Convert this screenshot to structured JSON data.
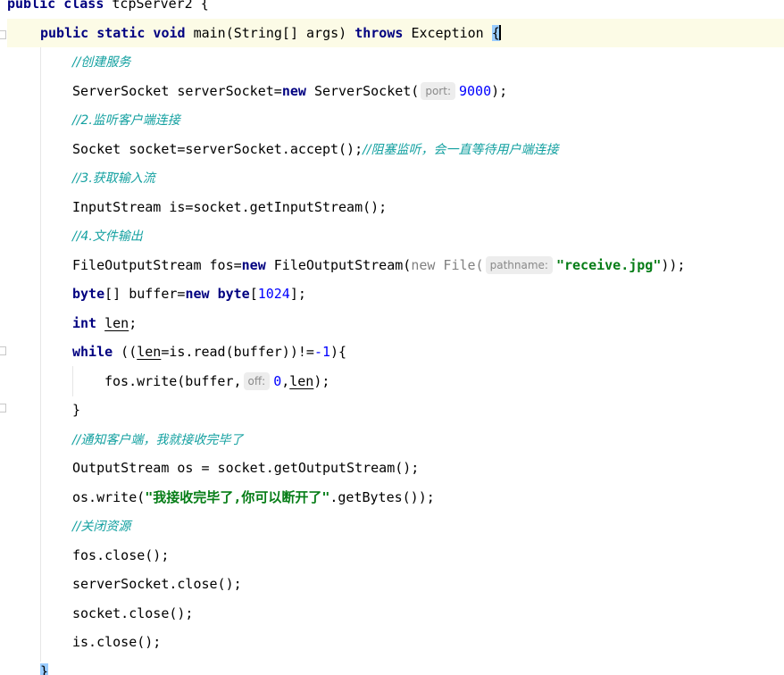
{
  "code": {
    "class_decl": {
      "kw": "public class",
      "name": "tcpServer2",
      "brace": "{"
    },
    "main_decl": {
      "kw": "public static void",
      "name": "main(String[] args)",
      "throws_kw": "throws",
      "exc": "Exception",
      "brace": "{"
    },
    "comment_create": "//创建服务",
    "server_socket": {
      "decl": "ServerSocket serverSocket=",
      "kw": "new",
      "ctor": "ServerSocket(",
      "hint": "port:",
      "num": "9000",
      "end": ");"
    },
    "comment_listen": "//2.监听客户端连接",
    "accept_line": {
      "code": "Socket socket=serverSocket.accept();",
      "comment": "//阻塞监听，会一直等待用户端连接"
    },
    "comment_input": "//3.获取输入流",
    "input_stream": "InputStream is=socket.getInputStream();",
    "comment_output": "//4.文件输出",
    "fos_line": {
      "decl": "FileOutputStream fos=",
      "kw": "new",
      "ctor": "FileOutputStream(",
      "inner": "new File(",
      "hint": "pathname:",
      "str": "\"receive.jpg\"",
      "end": "));"
    },
    "buffer_line": {
      "kw1": "byte",
      "mid": "[] buffer=",
      "kw2": "new",
      "kw3": "byte",
      "open": "[",
      "num": "1024",
      "end": "];"
    },
    "int_line": {
      "kw": "int",
      "var": "len",
      "end": ";"
    },
    "while_line": {
      "kw": "while",
      "p1": " ((",
      "var": "len",
      "p2": "=is.read(buffer))!=",
      "num": "-1",
      "end": "){"
    },
    "write_line": {
      "p1": "fos.write(buffer,",
      "hint": "off:",
      "num": "0",
      "comma": ",",
      "var": "len",
      "end": ");"
    },
    "close_brace": "}",
    "comment_notify": "//通知客户端，我就接收完毕了",
    "os_line": "OutputStream os = socket.getOutputStream();",
    "os_write": {
      "p1": "os.write(",
      "str": "\"我接收完毕了,你可以断开了\"",
      "end": ".getBytes());"
    },
    "comment_close": "//关闭资源",
    "close_lines": [
      "fos.close();",
      "serverSocket.close();",
      "socket.close();",
      "is.close();"
    ],
    "final_brace": "}"
  },
  "colors": {
    "keyword": "#000080",
    "number": "#0000ff",
    "string": "#067d17",
    "comment": "#12a0a0",
    "hint_bg": "#ededed",
    "caret_line": "#fcfbe6",
    "brace_highlight": "#99ccff"
  }
}
